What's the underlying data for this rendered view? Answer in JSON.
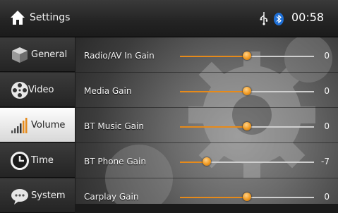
{
  "header": {
    "title": "Settings",
    "clock": "00:58",
    "icons": [
      "home-icon",
      "usb-icon",
      "bluetooth-icon"
    ]
  },
  "sidebar": {
    "items": [
      {
        "label": "General",
        "icon": "cube-icon",
        "active": false
      },
      {
        "label": "Video",
        "icon": "film-reel-icon",
        "active": false
      },
      {
        "label": "Volume",
        "icon": "volume-bars-icon",
        "active": true
      },
      {
        "label": "Time",
        "icon": "clock-icon",
        "active": false
      },
      {
        "label": "System",
        "icon": "speech-bubble-icon",
        "active": false
      }
    ]
  },
  "main": {
    "rows": [
      {
        "label": "Radio/AV In Gain",
        "value": "0",
        "level": 0.5
      },
      {
        "label": "Media Gain",
        "value": "0",
        "level": 0.5
      },
      {
        "label": "BT Music Gain",
        "value": "0",
        "level": 0.5
      },
      {
        "label": "BT Phone Gain",
        "value": "-7",
        "level": 0.2
      },
      {
        "label": "Carplay Gain",
        "value": "0",
        "level": 0.5
      }
    ]
  },
  "colors": {
    "accent": "#e68a1a",
    "bluetooth": "#1e6fd6"
  }
}
